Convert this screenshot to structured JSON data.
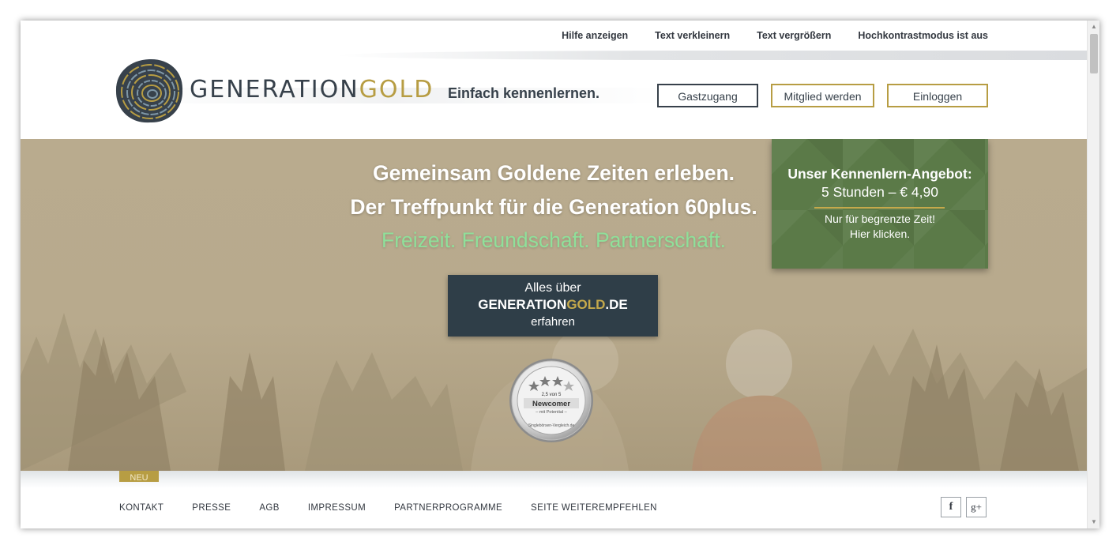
{
  "header": {
    "util_links": [
      "Hilfe anzeigen",
      "Text verkleinern",
      "Text vergrößern",
      "Hochkontrastmodus ist aus"
    ],
    "logo_part1": "GENERATION",
    "logo_part2": "GOLD",
    "tagline": "Einfach kennenlernen.",
    "buttons": {
      "guest": "Gastzugang",
      "member": "Mitglied werden",
      "login": "Einloggen"
    }
  },
  "hero": {
    "headline1": "Gemeinsam Goldene Zeiten erleben.",
    "headline2": "Der Treffpunkt für die Generation 60plus.",
    "subline": "Freizeit. Freundschaft. Partnerschaft.",
    "about_button": {
      "line1": "Alles über",
      "brand_part1": "GENERATION",
      "brand_part2": "GOLD",
      "brand_part3": ".DE",
      "line3": "erfahren"
    },
    "offer": {
      "title": "Unser Kennenlern-Angebot:",
      "price": "5 Stunden – € 4,90",
      "note1": "Nur für begrenzte Zeit!",
      "note2": "Hier klicken."
    },
    "seal": {
      "rating": "2,5 von 5",
      "label": "Newcomer",
      "sublabel": "– mit Potential –",
      "footer": "Singlebörsen-Vergleich.de"
    }
  },
  "footer": {
    "new_badge": "NEU",
    "links": [
      "KONTAKT",
      "PRESSE",
      "AGB",
      "IMPRESSUM",
      "PARTNERPROGRAMME",
      "SEITE WEITEREMPFEHLEN"
    ],
    "social": {
      "facebook": "f",
      "googleplus": "g+"
    }
  },
  "colors": {
    "brand_dark": "#37414b",
    "brand_gold": "#b79d43",
    "offer_green": "#5b7a48",
    "hero_beige": "#b9ab8e",
    "about_button_bg": "#2f3e48",
    "subline_green": "#8fe09a"
  },
  "icons": [
    "tree-ring-logo-icon",
    "facebook-icon",
    "google-plus-icon",
    "scroll-up-arrow-icon",
    "scroll-down-arrow-icon",
    "award-seal-icon"
  ]
}
